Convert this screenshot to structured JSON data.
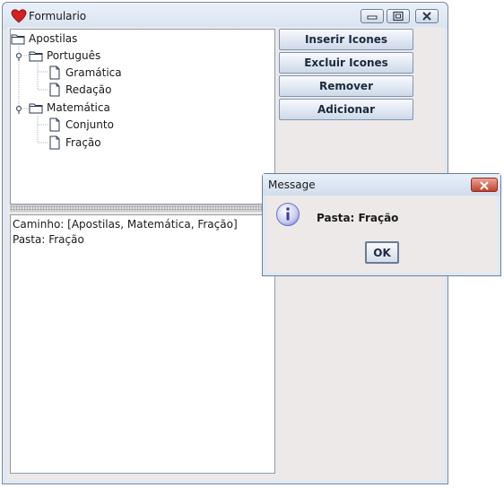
{
  "window": {
    "title": "Formulario",
    "controls": {
      "minimize_icon": "minimize-icon",
      "maximize_icon": "maximize-icon",
      "close_icon": "close-icon"
    }
  },
  "tree": {
    "root": "Apostilas",
    "folders": [
      {
        "label": "Português",
        "items": [
          "Gramática",
          "Redação"
        ]
      },
      {
        "label": "Matemática",
        "items": [
          "Conjunto",
          "Fração"
        ]
      }
    ]
  },
  "output": {
    "lines": [
      "Caminho: [Apostilas, Matemática, Fração]",
      "Pasta: Fração"
    ]
  },
  "buttons": {
    "inserir": "Inserir Icones",
    "excluir": "Excluir Icones",
    "remover": "Remover",
    "adicionar": "Adicionar"
  },
  "dialog": {
    "title": "Message",
    "message": "Pasta: Fração",
    "ok_label": "OK",
    "icon": "info-icon"
  },
  "colors": {
    "title_icon": "#d42020",
    "close_button": "#c3402d",
    "info_icon": "#6f74c8"
  }
}
